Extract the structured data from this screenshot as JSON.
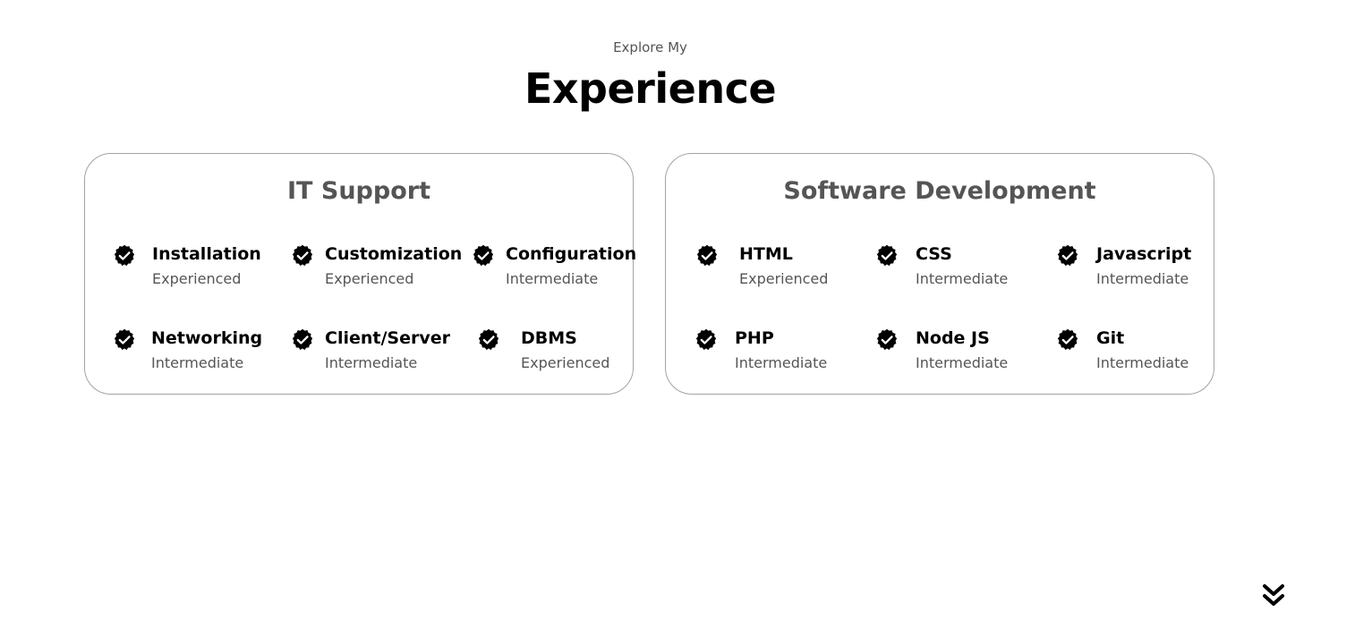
{
  "header": {
    "subtitle": "Explore My",
    "title": "Experience"
  },
  "cards": [
    {
      "title": "IT Support",
      "skills": [
        {
          "name": "Installation",
          "level": "Experienced"
        },
        {
          "name": "Customization",
          "level": "Experienced"
        },
        {
          "name": "Configuration",
          "level": "Intermediate"
        },
        {
          "name": "Networking",
          "level": "Intermediate"
        },
        {
          "name": "Client/Server",
          "level": "Intermediate"
        },
        {
          "name": "DBMS",
          "level": "Experienced"
        }
      ]
    },
    {
      "title": "Software Development",
      "skills": [
        {
          "name": "HTML",
          "level": "Experienced"
        },
        {
          "name": "CSS",
          "level": "Intermediate"
        },
        {
          "name": "Javascript",
          "level": "Intermediate"
        },
        {
          "name": "PHP",
          "level": "Intermediate"
        },
        {
          "name": "Node JS",
          "level": "Intermediate"
        },
        {
          "name": "Git",
          "level": "Intermediate"
        }
      ]
    }
  ],
  "icons": {
    "skill_badge": "verified-check-icon",
    "scroll": "double-chevron-down-icon"
  }
}
